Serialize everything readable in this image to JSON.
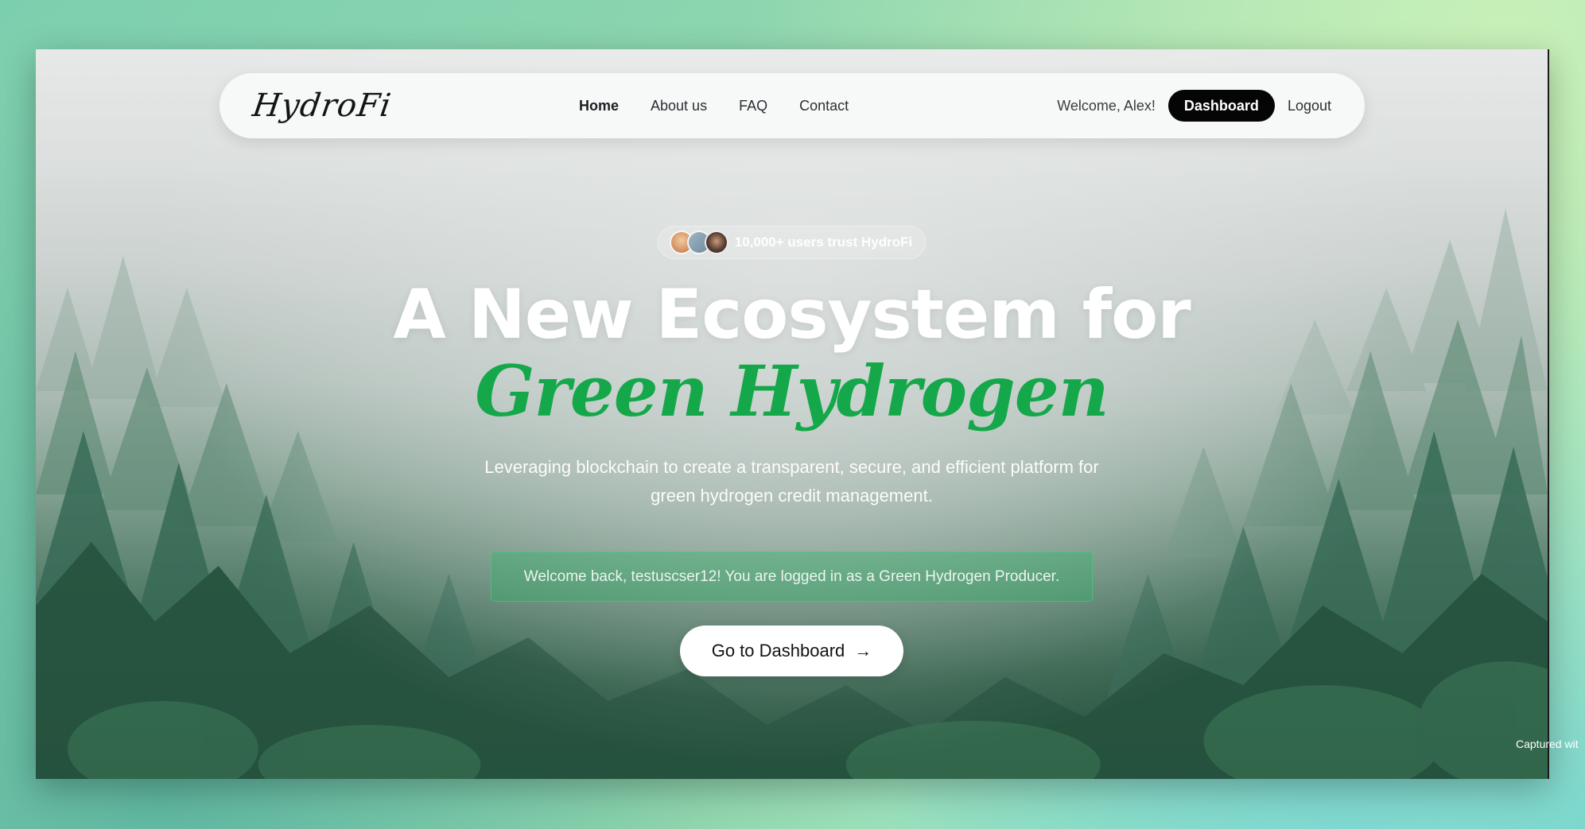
{
  "navbar": {
    "logo": "HydroFi",
    "links": [
      "Home",
      "About us",
      "FAQ",
      "Contact"
    ],
    "welcome": "Welcome, Alex!",
    "dashboard_label": "Dashboard",
    "logout_label": "Logout"
  },
  "hero": {
    "trust_text": "10,000+ users trust HydroFi",
    "title_line1": "A New Ecosystem for",
    "title_line2": "Green Hydrogen",
    "subtitle": "Leveraging blockchain to create a transparent, secure, and efficient platform for green hydrogen credit management.",
    "notice": "Welcome back, testuscser12! You are logged in as a Green Hydrogen Producer.",
    "cta_label": "Go to Dashboard",
    "cta_icon": "→"
  },
  "capture_label": "Captured wit",
  "colors": {
    "accent_green": "#15a84a",
    "dark_button": "#050505"
  }
}
